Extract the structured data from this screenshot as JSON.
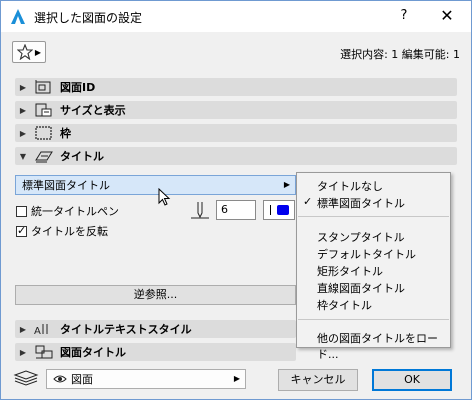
{
  "window": {
    "title": "選択した図面の設定",
    "help_label": "?",
    "close_label": "✕"
  },
  "header": {
    "selection_info": "選択内容: 1 編集可能: 1"
  },
  "sections": {
    "drawing_id": "図面ID",
    "size_display": "サイズと表示",
    "frame": "枠",
    "title": "タイトル",
    "title_text_style": "タイトルテキストスタイル",
    "drawing_title": "図面タイトル"
  },
  "title_panel": {
    "dropdown_value": "標準図面タイトル",
    "uniform_pen_label": "統一タイトルペン",
    "uniform_pen_checked": false,
    "flip_title_label": "タイトルを反転",
    "flip_title_checked": true,
    "pen_number": "6",
    "pen_color": "#0000ee",
    "xref_button": "逆参照..."
  },
  "menu": {
    "items_top": [
      {
        "label": "タイトルなし",
        "checked": false
      },
      {
        "label": "標準図面タイトル",
        "checked": true
      }
    ],
    "items_mid": [
      "スタンプタイトル",
      "デフォルトタイトル",
      "矩形タイトル",
      "直線図面タイトル",
      "枠タイトル"
    ],
    "items_bottom": [
      "他の図面タイトルをロード..."
    ],
    "check_mark": "✓"
  },
  "footer": {
    "view_value": "図面",
    "cancel_label": "キャンセル",
    "ok_label": "OK"
  },
  "colors": {
    "selected_bg": "#d6e7f9",
    "accent": "#0078d7"
  }
}
